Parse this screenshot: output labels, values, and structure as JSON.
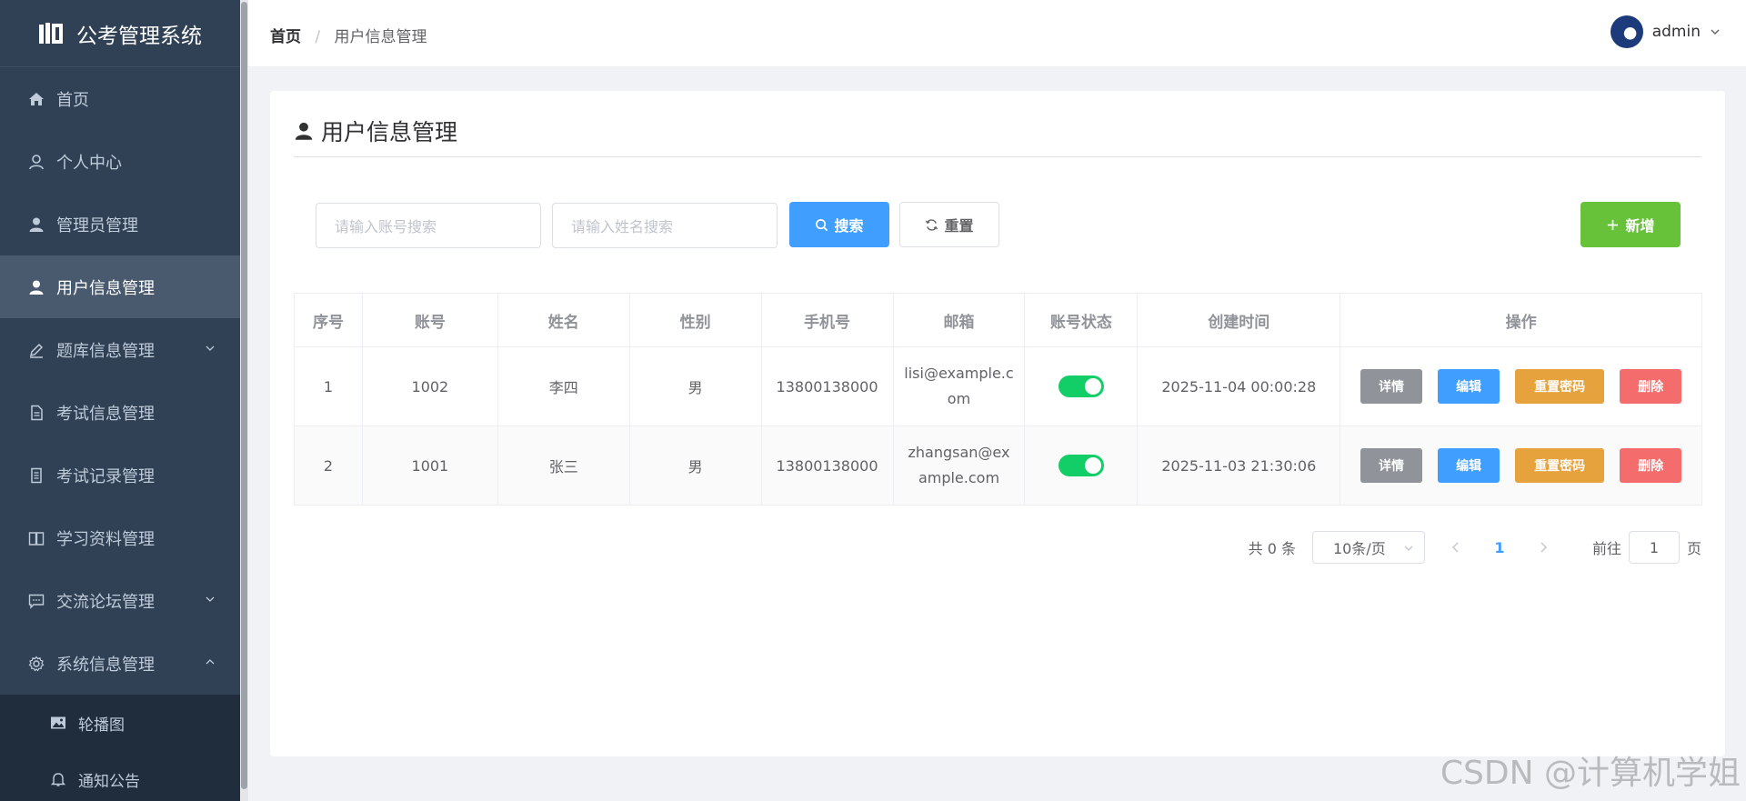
{
  "app": {
    "title": "公考管理系统"
  },
  "sidebar": {
    "items": [
      {
        "label": "首页",
        "icon": "home-icon"
      },
      {
        "label": "个人中心",
        "icon": "user-outline-icon"
      },
      {
        "label": "管理员管理",
        "icon": "user-icon"
      },
      {
        "label": "用户信息管理",
        "icon": "user-icon",
        "active": true
      },
      {
        "label": "题库信息管理",
        "icon": "edit-icon",
        "expandable": true
      },
      {
        "label": "考试信息管理",
        "icon": "document-icon"
      },
      {
        "label": "考试记录管理",
        "icon": "document-icon"
      },
      {
        "label": "学习资料管理",
        "icon": "book-icon"
      },
      {
        "label": "交流论坛管理",
        "icon": "chat-icon",
        "expandable": true
      },
      {
        "label": "系统信息管理",
        "icon": "gear-icon",
        "expanded": true
      }
    ],
    "subitems": [
      {
        "label": "轮播图",
        "icon": "picture-icon"
      },
      {
        "label": "通知公告",
        "icon": "bell-icon"
      }
    ]
  },
  "header": {
    "breadcrumb": {
      "home": "首页",
      "separator": "/",
      "current": "用户信息管理"
    },
    "user": {
      "name": "admin"
    }
  },
  "page": {
    "title": "用户信息管理",
    "search": {
      "account_placeholder": "请输入账号搜索",
      "name_placeholder": "请输入姓名搜索",
      "search_label": "搜索",
      "reset_label": "重置",
      "add_label": "新增"
    },
    "table": {
      "columns": [
        "序号",
        "账号",
        "姓名",
        "性别",
        "手机号",
        "邮箱",
        "账号状态",
        "创建时间",
        "操作"
      ],
      "rows": [
        {
          "index": "1",
          "account": "1002",
          "name": "李四",
          "gender": "男",
          "phone": "13800138000",
          "email_line1": "lisi@example.c",
          "email_line2": "om",
          "status_on": true,
          "created": "2025-11-04 00:00:28"
        },
        {
          "index": "2",
          "account": "1001",
          "name": "张三",
          "gender": "男",
          "phone": "13800138000",
          "email_line1": "zhangsan@ex",
          "email_line2": "ample.com",
          "status_on": true,
          "created": "2025-11-03 21:30:06"
        }
      ],
      "actions": {
        "detail": "详情",
        "edit": "编辑",
        "reset_password": "重置密码",
        "delete": "删除"
      }
    },
    "pagination": {
      "total": "共 0 条",
      "page_size": "10条/页",
      "current_page": "1",
      "goto_label": "前往",
      "goto_value": "1",
      "page_suffix": "页"
    }
  },
  "watermark": "CSDN @计算机学姐",
  "colors": {
    "sidebar_bg": "#304156",
    "primary": "#409eff",
    "success": "#67c23a",
    "warning": "#e6a23c",
    "danger": "#f56c6c",
    "info": "#909399",
    "switch_on": "#13ce66"
  }
}
